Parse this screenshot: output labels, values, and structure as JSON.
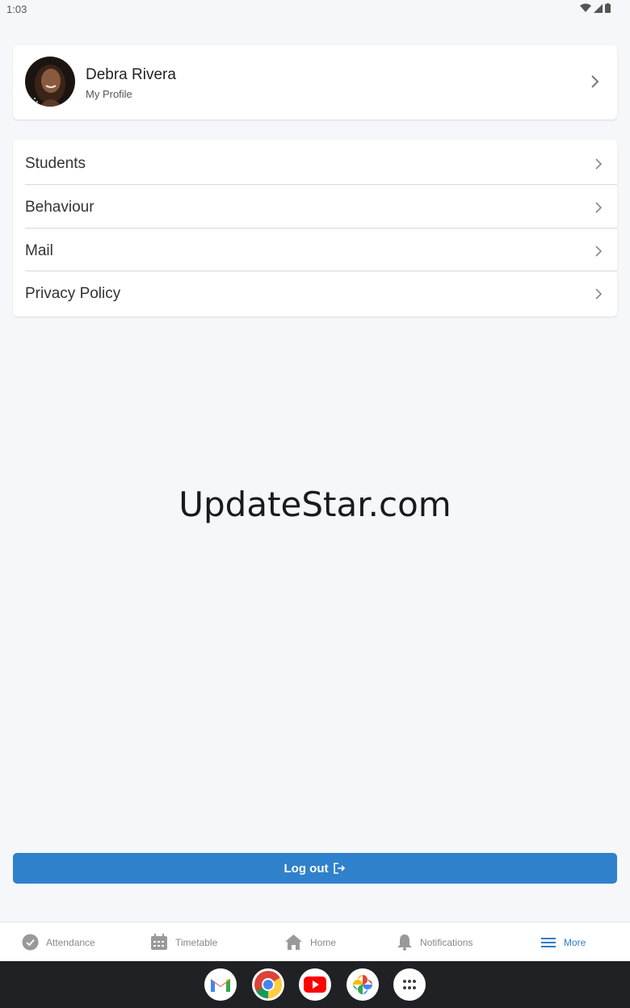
{
  "status_bar": {
    "time": "1:03"
  },
  "profile": {
    "name": "Debra Rivera",
    "subtitle": "My Profile"
  },
  "menu": [
    {
      "label": "Students"
    },
    {
      "label": "Behaviour"
    },
    {
      "label": "Mail"
    },
    {
      "label": "Privacy Policy"
    }
  ],
  "watermark": "UpdateStar.com",
  "logout": {
    "label": "Log out"
  },
  "bottom_nav": [
    {
      "label": "Attendance",
      "icon": "check-circle-icon"
    },
    {
      "label": "Timetable",
      "icon": "calendar-icon"
    },
    {
      "label": "Home",
      "icon": "home-icon"
    },
    {
      "label": "Notifications",
      "icon": "bell-icon"
    },
    {
      "label": "More",
      "icon": "menu-icon",
      "active": true
    }
  ],
  "dock": [
    "gmail-icon",
    "chrome-icon",
    "youtube-icon",
    "photos-icon",
    "app-drawer-icon"
  ],
  "colors": {
    "accent": "#3081cb",
    "nav_active": "#2f7cc7",
    "background": "#f5f7fa"
  }
}
